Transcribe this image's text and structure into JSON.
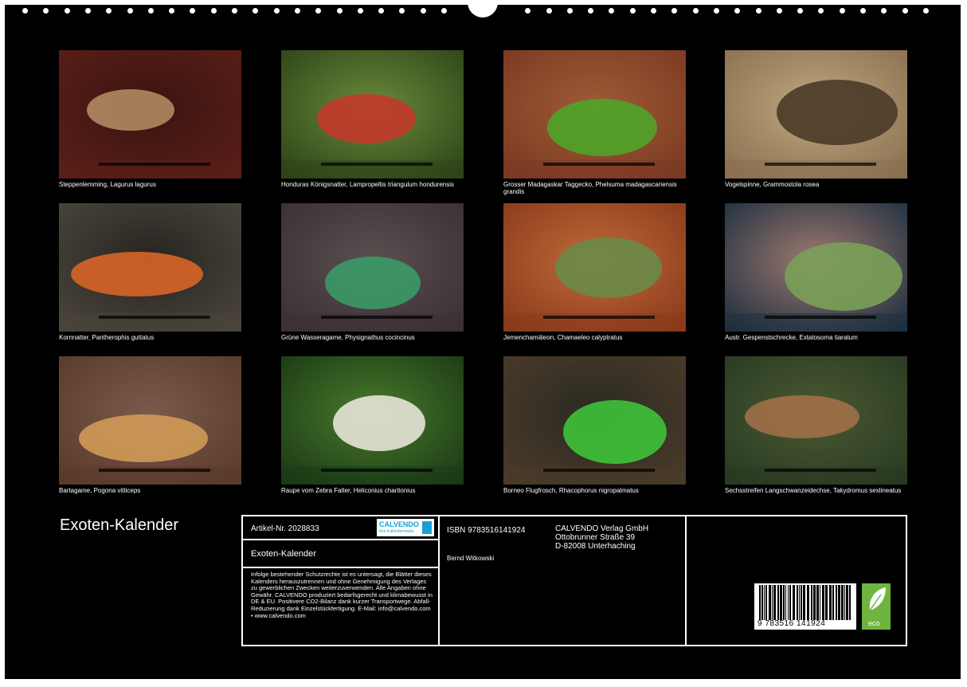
{
  "photos": [
    {
      "caption": "Steppenlemming, Lagurus lagurus",
      "colors": [
        "#5a1e18",
        "#b08a62",
        "#3a1410"
      ]
    },
    {
      "caption": "Honduras Königsnatter, Lampropeltis triangulum hondurensis",
      "colors": [
        "#2e4418",
        "#c23a2a",
        "#6a8a3a"
      ]
    },
    {
      "caption": "Grosser Madagaskar Taggecko, Phelsuma madagascariensis grandis",
      "colors": [
        "#7a3a22",
        "#4ea428",
        "#a05a36"
      ]
    },
    {
      "caption": "Vogelspinne, Grammostola rosea",
      "colors": [
        "#8a7050",
        "#4a3a28",
        "#c0a880"
      ]
    },
    {
      "caption": "Kornnatter, Pantherophis guttatus",
      "colors": [
        "#4a443c",
        "#d86428",
        "#262420"
      ]
    },
    {
      "caption": "Grüne Wasseragame, Physignathus cocincinus",
      "colors": [
        "#3a3036",
        "#3a9a66",
        "#5a5050"
      ]
    },
    {
      "caption": "Jemenchamäleon, Chamaeleo calyptratus",
      "colors": [
        "#8a3a1a",
        "#6a8a48",
        "#c06a3a"
      ]
    },
    {
      "caption": "Austr. Gespenstschrecke, Extatosoma tiaratum",
      "colors": [
        "#1e3040",
        "#7aa058",
        "#a07a70"
      ]
    },
    {
      "caption": "Bartagame, Pogona vitticeps",
      "colors": [
        "#5a3a2a",
        "#d09a58",
        "#7a5a4a"
      ]
    },
    {
      "caption": "Raupe vom Zebra Falter, Heliconius charitonius",
      "colors": [
        "#1a3a16",
        "#e8e4d8",
        "#4a7a2a"
      ]
    },
    {
      "caption": "Borneo Flugfrosch, Rhacophorus nigropalmatus",
      "colors": [
        "#4a3a2a",
        "#3ec23a",
        "#2a2a22"
      ]
    },
    {
      "caption": "Sechsstreifen Langschwanzeidechse, Takydromus sexlineatus",
      "colors": [
        "#2a3a22",
        "#a07048",
        "#4a5a32"
      ]
    }
  ],
  "calendar_title": "Exoten-Kalender",
  "info": {
    "article": "Artikel-Nr. 2028833",
    "title": "Exoten-Kalender",
    "legal": "Infolge bestehender Schutzrechte ist es untersagt, die Blätter dieses Kalenders herauszutrennen und ohne Genehmigung des Verlages zu gewerblichen Zwecken weiterzuverwenden. Alle Angaben ohne Gewähr. CALVENDO produziert bedarfsgerecht und klimabewusst in DE & EU. Positivere CO2-Bilanz dank kurzer Transportwege. Abfall-Reduzierung dank Einzelstückfertigung. E-Mail: info@calvendo.com • www.calvendo.com",
    "isbn": "ISBN 9783516141924",
    "author": "Bernd Witkowski",
    "publisher_name": "CALVENDO Verlag GmbH",
    "publisher_street": "Ottobrunner Straße 39",
    "publisher_city": "D-82008 Unterhaching",
    "logo_text": "CALVENDO",
    "logo_sub": "Ihre Kalendermarke",
    "barcode_digits": "9 783516 141924",
    "eco_label": "eco"
  },
  "accent_colors": {
    "background": "#000000",
    "text": "#ffffff",
    "logo": "#1aa0d8",
    "eco": "#6fb43f"
  }
}
